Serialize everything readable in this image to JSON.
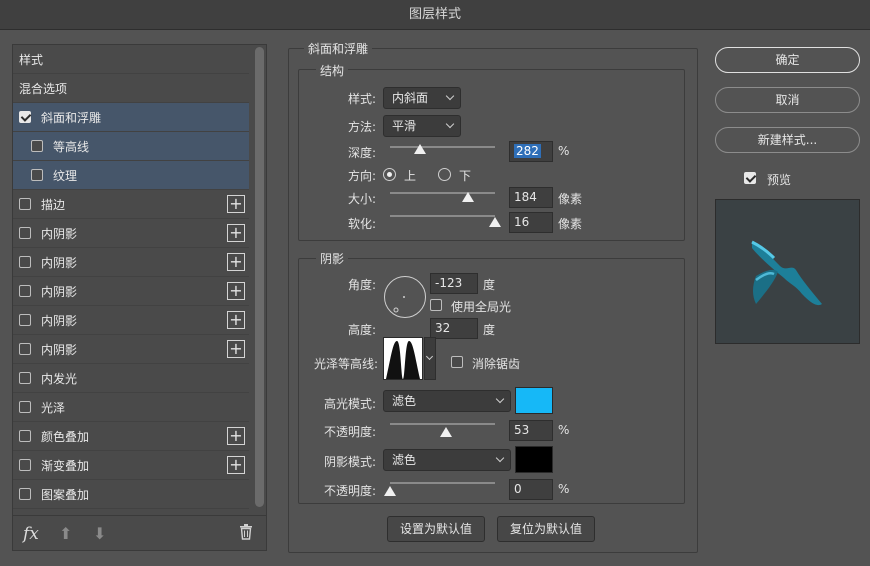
{
  "window": {
    "title": "图层样式"
  },
  "sidebar": {
    "items": [
      {
        "label": "样式",
        "type": "header"
      },
      {
        "label": "混合选项",
        "type": "header"
      },
      {
        "label": "斜面和浮雕",
        "checked": true,
        "selected": true,
        "indent": false,
        "plus": false
      },
      {
        "label": "等高线",
        "checked": false,
        "selected": true,
        "indent": true,
        "plus": false
      },
      {
        "label": "纹理",
        "checked": false,
        "selected": true,
        "indent": true,
        "plus": false
      },
      {
        "label": "描边",
        "checked": false,
        "plus": true
      },
      {
        "label": "内阴影",
        "checked": false,
        "plus": true
      },
      {
        "label": "内阴影",
        "checked": false,
        "plus": true
      },
      {
        "label": "内阴影",
        "checked": false,
        "plus": true
      },
      {
        "label": "内阴影",
        "checked": false,
        "plus": true
      },
      {
        "label": "内阴影",
        "checked": false,
        "plus": true
      },
      {
        "label": "内发光",
        "checked": false,
        "plus": false
      },
      {
        "label": "光泽",
        "checked": false,
        "plus": false
      },
      {
        "label": "颜色叠加",
        "checked": false,
        "plus": true
      },
      {
        "label": "渐变叠加",
        "checked": false,
        "plus": true
      },
      {
        "label": "图案叠加",
        "checked": false,
        "plus": false
      }
    ],
    "toolbar": {
      "fx": "fx",
      "up_icon": "arrow-up-icon",
      "down_icon": "arrow-down-icon",
      "trash_icon": "trash-icon"
    }
  },
  "bevel": {
    "group_title": "斜面和浮雕",
    "structure": {
      "title": "结构",
      "style_label": "样式:",
      "style_value": "内斜面",
      "technique_label": "方法:",
      "technique_value": "平滑",
      "depth_label": "深度:",
      "depth_value": "282",
      "depth_unit": "%",
      "depth_slider_fraction": 0.29,
      "direction_label": "方向:",
      "direction_up": "上",
      "direction_down": "下",
      "direction_selected": "上",
      "size_label": "大小:",
      "size_value": "184",
      "size_unit": "像素",
      "size_slider_fraction": 0.74,
      "soften_label": "软化:",
      "soften_value": "16",
      "soften_unit": "像素",
      "soften_slider_fraction": 1.0
    },
    "shading": {
      "title": "阴影",
      "angle_label": "角度:",
      "angle_value": "-123",
      "angle_unit": "度",
      "global_light_label": "使用全局光",
      "global_light_checked": false,
      "altitude_label": "高度:",
      "altitude_value": "32",
      "altitude_unit": "度",
      "gloss_contour_label": "光泽等高线:",
      "antialias_label": "消除锯齿",
      "antialias_checked": false,
      "highlight_mode_label": "高光模式:",
      "highlight_mode_value": "滤色",
      "highlight_color": "#16b8f7",
      "highlight_opacity_label": "不透明度:",
      "highlight_opacity_value": "53",
      "highlight_opacity_unit": "%",
      "highlight_opacity_fraction": 0.53,
      "shadow_mode_label": "阴影模式:",
      "shadow_mode_value": "滤色",
      "shadow_color": "#000000",
      "shadow_opacity_label": "不透明度:",
      "shadow_opacity_value": "0",
      "shadow_opacity_unit": "%",
      "shadow_opacity_fraction": 0.0
    },
    "make_default": "设置为默认值",
    "reset_default": "复位为默认值"
  },
  "actions": {
    "ok": "确定",
    "cancel": "取消",
    "new_style": "新建样式...",
    "preview_label": "预览",
    "preview_checked": true
  }
}
